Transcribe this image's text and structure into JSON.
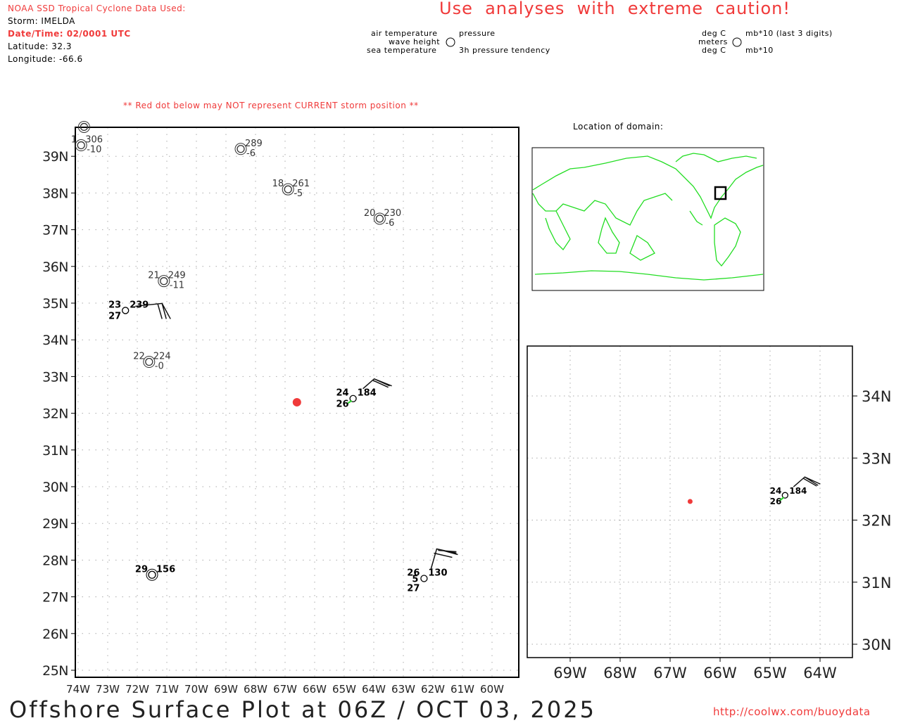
{
  "header": {
    "source": "NOAA SSD Tropical Cyclone Data Used:",
    "storm": "Storm: IMELDA",
    "datetime": "Date/Time: 02/0001 UTC",
    "latitude": "Latitude: 32.3",
    "longitude": "Longitude: -66.6",
    "caution": "Use  analyses  with  extreme  caution!",
    "red_dot_note": "** Red dot below may NOT represent CURRENT storm position **"
  },
  "legend": {
    "air_temperature": "air temperature",
    "wave_height": "wave height",
    "sea_temperature": "sea temperature",
    "pressure": "pressure",
    "pressure_tendency": "3h pressure tendency",
    "unit_air": "deg C",
    "unit_wave": "meters",
    "unit_sea": "deg C",
    "unit_pressure": "mb*10 (last 3 digits)",
    "unit_tendency": "mb*10"
  },
  "main_map": {
    "lat_labels": [
      "39N",
      "38N",
      "37N",
      "36N",
      "35N",
      "34N",
      "33N",
      "32N",
      "31N",
      "30N",
      "29N",
      "28N",
      "27N",
      "26N",
      "25N"
    ],
    "lon_labels": [
      "74W",
      "73W",
      "72W",
      "71W",
      "70W",
      "69W",
      "68W",
      "67W",
      "66W",
      "65W",
      "64W",
      "63W",
      "62W",
      "61W",
      "60W"
    ],
    "storm_position": {
      "lat": 32.3,
      "lon": -66.6
    },
    "stations": [
      {
        "lat": 39.8,
        "lon": -73.8,
        "style": "gray",
        "double": true,
        "air": "",
        "sea": "",
        "wave": "",
        "pressure": "",
        "tendency": ""
      },
      {
        "lat": 39.3,
        "lon": -73.9,
        "style": "gray",
        "double": true,
        "air": "1",
        "sea": "",
        "wave": "",
        "pressure": "306",
        "tendency": "-10"
      },
      {
        "lat": 39.2,
        "lon": -68.5,
        "style": "gray",
        "double": true,
        "air": "",
        "sea": "",
        "wave": "",
        "pressure": "289",
        "tendency": "-6"
      },
      {
        "lat": 38.1,
        "lon": -66.9,
        "style": "gray",
        "double": true,
        "air": "18",
        "sea": "",
        "wave": "",
        "pressure": "261",
        "tendency": "-5"
      },
      {
        "lat": 37.3,
        "lon": -63.8,
        "style": "gray",
        "double": true,
        "air": "20",
        "sea": "",
        "wave": "",
        "pressure": "230",
        "tendency": "-6"
      },
      {
        "lat": 35.6,
        "lon": -71.1,
        "style": "gray",
        "double": true,
        "air": "21",
        "sea": "",
        "wave": "",
        "pressure": "249",
        "tendency": "-11"
      },
      {
        "lat": 34.8,
        "lon": -72.4,
        "style": "black",
        "double": false,
        "air": "23",
        "sea": "27",
        "wave": "",
        "pressure": "239",
        "tendency": "",
        "barb": "w"
      },
      {
        "lat": 33.4,
        "lon": -71.6,
        "style": "gray",
        "double": true,
        "air": "22",
        "sea": "",
        "wave": "",
        "pressure": "224",
        "tendency": "-0"
      },
      {
        "lat": 32.4,
        "lon": -64.7,
        "style": "black",
        "double": false,
        "air": "24",
        "sea": "26",
        "wave": "",
        "pressure": "184",
        "tendency": "",
        "barb": "sw",
        "green": true
      },
      {
        "lat": 27.6,
        "lon": -71.5,
        "style": "black",
        "double": true,
        "air": "29",
        "sea": "",
        "wave": "",
        "pressure": "156",
        "tendency": ""
      },
      {
        "lat": 27.5,
        "lon": -62.3,
        "style": "black",
        "double": false,
        "air": "26",
        "sea": "27",
        "wave": "5",
        "pressure": "130",
        "tendency": "",
        "barb": "s"
      }
    ]
  },
  "domain_map": {
    "title": "Location of domain:"
  },
  "zoom_map": {
    "lat_labels": [
      "34N",
      "33N",
      "32N",
      "31N",
      "30N"
    ],
    "lon_labels": [
      "69W",
      "68W",
      "67W",
      "66W",
      "65W",
      "64W"
    ],
    "storm_position": {
      "lat": 32.3,
      "lon": -66.6
    },
    "station": {
      "lat": 32.4,
      "lon": -64.7,
      "air": "24",
      "sea": "26",
      "pressure": "184"
    }
  },
  "footer": {
    "title": "Offshore Surface Plot at 06Z / OCT 03, 2025",
    "url": "http://coolwx.com/buoydata"
  },
  "colors": {
    "accent_red": "#f03a3a",
    "coast_green": "#22dd22",
    "grid": "#aaaaaa"
  }
}
